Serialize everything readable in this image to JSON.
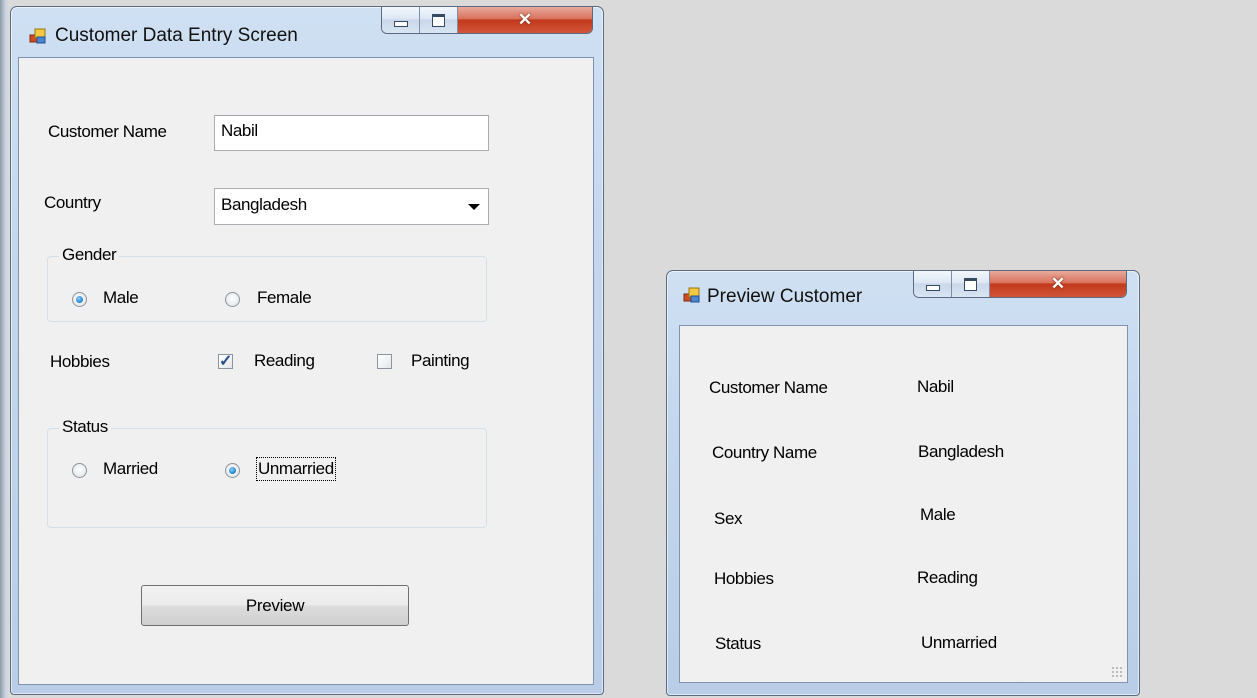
{
  "main_window": {
    "title": "Customer Data Entry Screen",
    "customer_name_label": "Customer Name",
    "customer_name_value": "Nabil",
    "country_label": "Country",
    "country_selected": "Bangladesh",
    "gender_group_title": "Gender",
    "gender_options": [
      "Male",
      "Female"
    ],
    "gender_selected": "Male",
    "hobbies_label": "Hobbies",
    "hobbies_options": [
      "Reading",
      "Painting"
    ],
    "hobbies_checked": [
      "Reading"
    ],
    "status_group_title": "Status",
    "status_options": [
      "Married",
      "Unmarried"
    ],
    "status_selected": "Unmarried",
    "preview_button": "Preview"
  },
  "preview_window": {
    "title": "Preview Customer",
    "rows": [
      {
        "label": "Customer Name",
        "value": "Nabil"
      },
      {
        "label": "Country Name",
        "value": "Bangladesh"
      },
      {
        "label": "Sex",
        "value": "Male"
      },
      {
        "label": "Hobbies",
        "value": "Reading"
      },
      {
        "label": "Status",
        "value": "Unmarried"
      }
    ]
  },
  "colors": {
    "desktop_background": "#dadada",
    "client_background": "#f0f0f0",
    "close_button": "#c2391b",
    "radio_checked": "#2a8ad4"
  },
  "icons": {
    "app_icon": "windows-form-icon",
    "minimize": "minimize-icon",
    "maximize": "maximize-icon",
    "close": "close-icon",
    "dropdown": "chevron-down-icon",
    "resize_grip": "resize-grip-icon"
  }
}
